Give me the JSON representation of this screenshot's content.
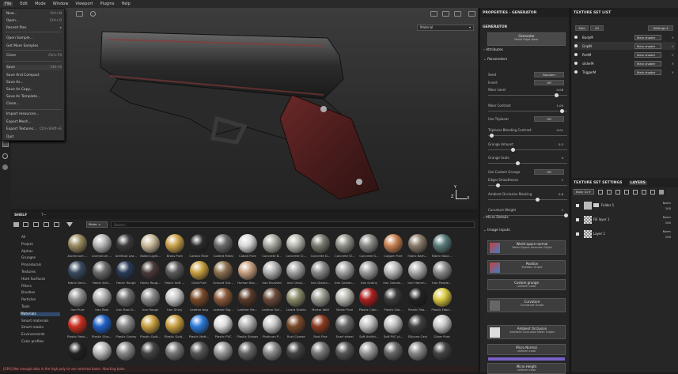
{
  "menubar": {
    "items": [
      "File",
      "Edit",
      "Mode",
      "Window",
      "Viewport",
      "Plugins",
      "Help"
    ]
  },
  "file_menu": {
    "items": [
      {
        "label": "New...",
        "shortcut": "Ctrl+N"
      },
      {
        "label": "Open...",
        "shortcut": "Ctrl+O"
      },
      {
        "label": "Recent files",
        "shortcut": "▸"
      },
      {
        "label": "Open Sample...",
        "shortcut": ""
      },
      {
        "label": "Get More Samples",
        "shortcut": ""
      },
      {
        "label": "Close",
        "shortcut": "Ctrl+F4"
      },
      {
        "label": "Save",
        "shortcut": "Ctrl+S"
      },
      {
        "label": "Save And Compact",
        "shortcut": ""
      },
      {
        "label": "Save As...",
        "shortcut": ""
      },
      {
        "label": "Save As Copy...",
        "shortcut": ""
      },
      {
        "label": "Save As Template...",
        "shortcut": ""
      },
      {
        "label": "Clean...",
        "shortcut": ""
      },
      {
        "label": "Import resources...",
        "shortcut": ""
      },
      {
        "label": "Export Mesh...",
        "shortcut": ""
      },
      {
        "label": "Export Textures...",
        "shortcut": "Ctrl+Shift+E"
      },
      {
        "label": "Quit",
        "shortcut": ""
      }
    ]
  },
  "viewport": {
    "mode_select": "Material",
    "axis_x": "X",
    "axis_y": "Y",
    "axis_z": "Z"
  },
  "shelf": {
    "tabs": [
      "SHELF",
      "T~"
    ],
    "filter_chip": "Mater ×",
    "search_placeholder": "Search...",
    "categories": [
      "All",
      "Project",
      "Alphas",
      "Grunges",
      "Procedurals",
      "Textures",
      "Hard Surfaces",
      "Filters",
      "Brushes",
      "Particles",
      "Tools",
      "Materials",
      "Smart materials",
      "Smart masks",
      "Environments",
      "Color profiles"
    ],
    "selected_category": "Materials",
    "materials": [
      [
        "Aluminium ...",
        "Aluminium ...",
        "Artificial Lea...",
        "Baked Light...",
        "Brass Pure",
        "Carbon Fiber",
        "Coated Metal",
        "Cobalt Pure",
        "Concrete B...",
        "Concrete Cl...",
        "Concrete D...",
        "Concrete Sl...",
        "Concrete S...",
        "Copper Pure",
        "Fabric Bam...",
        "Fabric Base..."
      ],
      [
        "Fabric Deni...",
        "Fabric Knit...",
        "Fabric Rough",
        "Fabric Roug...",
        "Fabric Soft ...",
        "Gold Pure",
        "Ground Gra...",
        "Human Bac...",
        "Iron Brushed",
        "Iron Chain...",
        "Iron Diamo...",
        "Iron Galvan...",
        "Iron Grainy",
        "Iron Galvan...",
        "Iron Hamm...",
        "Iron Powde..."
      ],
      [
        "Iron Pure",
        "Iron Raw",
        "Iron Raw D...",
        "Iron Rough",
        "Iron Shiny",
        "Leather bag",
        "Leather Big...",
        "Leather Me...",
        "Leather Sof...",
        "Lizard Scales",
        "Mortar Wall",
        "Nickel Pure",
        "Plastic Cabl...",
        "Plastic Dia...",
        "Plastic Fab...",
        "Plastic Fabri..."
      ],
      [
        "Plastic Fabri...",
        "Plastic Glos...",
        "Plastic Grainy",
        "Plastic Gold...",
        "Plastic Gold...",
        "Plastic Matt...",
        "Plastic PVC",
        "Plastic Stripes",
        "Platinum P...",
        "Rust Coarse",
        "Rust Fine",
        "Scarf wheel",
        "Soft Artifici...",
        "Soft PVC pl...",
        "Silicone Cast",
        "Silver Pure"
      ],
      [
        "",
        "",
        "",
        "",
        "",
        "",
        "",
        "",
        "",
        "",
        "",
        "",
        "",
        "",
        "",
        ""
      ]
    ]
  },
  "properties": {
    "header": "PROPERTIES - GENERATOR",
    "section": "GENERATOR",
    "generator_title": "Generator",
    "generator_name": "Metal Edge Wear",
    "attributes": "Attributes",
    "parameters": "Parameters",
    "params": [
      {
        "label": "Seed",
        "value": "Random"
      },
      {
        "label": "Invert",
        "value": "Off"
      },
      {
        "label": "Wear Level",
        "value": "0.08",
        "level": 0.88
      },
      {
        "label": "Wear Contrast",
        "value": "1.00",
        "level": 0.95
      },
      {
        "label": "Use Triplanar",
        "value": "Off"
      },
      {
        "label": "Triplanar Blending Contrast",
        "value": "0.01",
        "level": 0.02
      },
      {
        "label": "Grunge Amount",
        "value": "0.5",
        "level": 0.3
      },
      {
        "label": "Grunge Scale",
        "value": "4",
        "level": 0.36
      },
      {
        "label": "Use Custom Grunge",
        "value": "Off"
      },
      {
        "label": "Edges Smoothness",
        "value": "1",
        "level": 0.1
      },
      {
        "label": "Ambient Occlusion Masking",
        "value": "0.8",
        "level": 0.62
      },
      {
        "label": "Curvature Weight",
        "value": "1",
        "level": 1.0
      }
    ],
    "micro_details": "Micro Details",
    "image_inputs": "Image inputs",
    "inputs": [
      {
        "title": "World space normal",
        "sub": "World Space Normals Gripbl"
      },
      {
        "title": "Position",
        "sub": "Position Gripbl"
      },
      {
        "title": "Custom grunge",
        "sub": "uniform color"
      },
      {
        "title": "Curvature",
        "sub": "Curvature Gripbl"
      },
      {
        "title": "Ambient Occlusion",
        "sub": "Ambient Occlusion Mesh Gripbl"
      },
      {
        "title": "Micro Normal",
        "sub": "uniform color"
      },
      {
        "title": "Micro Height",
        "sub": "uniform color"
      }
    ]
  },
  "texture_set_list": {
    "header": "TEXTURE SET LIST",
    "solo": "Solo",
    "all": "All",
    "settings": "Settings ▾",
    "sets": [
      {
        "name": "BodyM",
        "shader": "Main shader"
      },
      {
        "name": "GripM",
        "shader": "Main shader"
      },
      {
        "name": "PartM",
        "shader": "Main shader"
      },
      {
        "name": "sliderM",
        "shader": "Main shader"
      },
      {
        "name": "TriggerM",
        "shader": "Main shader"
      }
    ]
  },
  "layers": {
    "header_tabs": [
      "TEXTURE SET SETTINGS",
      "LAYERS"
    ],
    "channel": "Base Co ▾",
    "items": [
      {
        "name": "Folder 1",
        "blend": "Norm",
        "opacity": "100"
      },
      {
        "name": "Fill layer 1",
        "blend": "Norm",
        "opacity": "100"
      },
      {
        "name": "Layer 1",
        "blend": "Norm",
        "opacity": "100"
      }
    ]
  },
  "status": "[GPU] Not enough data in the high poly to use selected baker. Aborting bake."
}
